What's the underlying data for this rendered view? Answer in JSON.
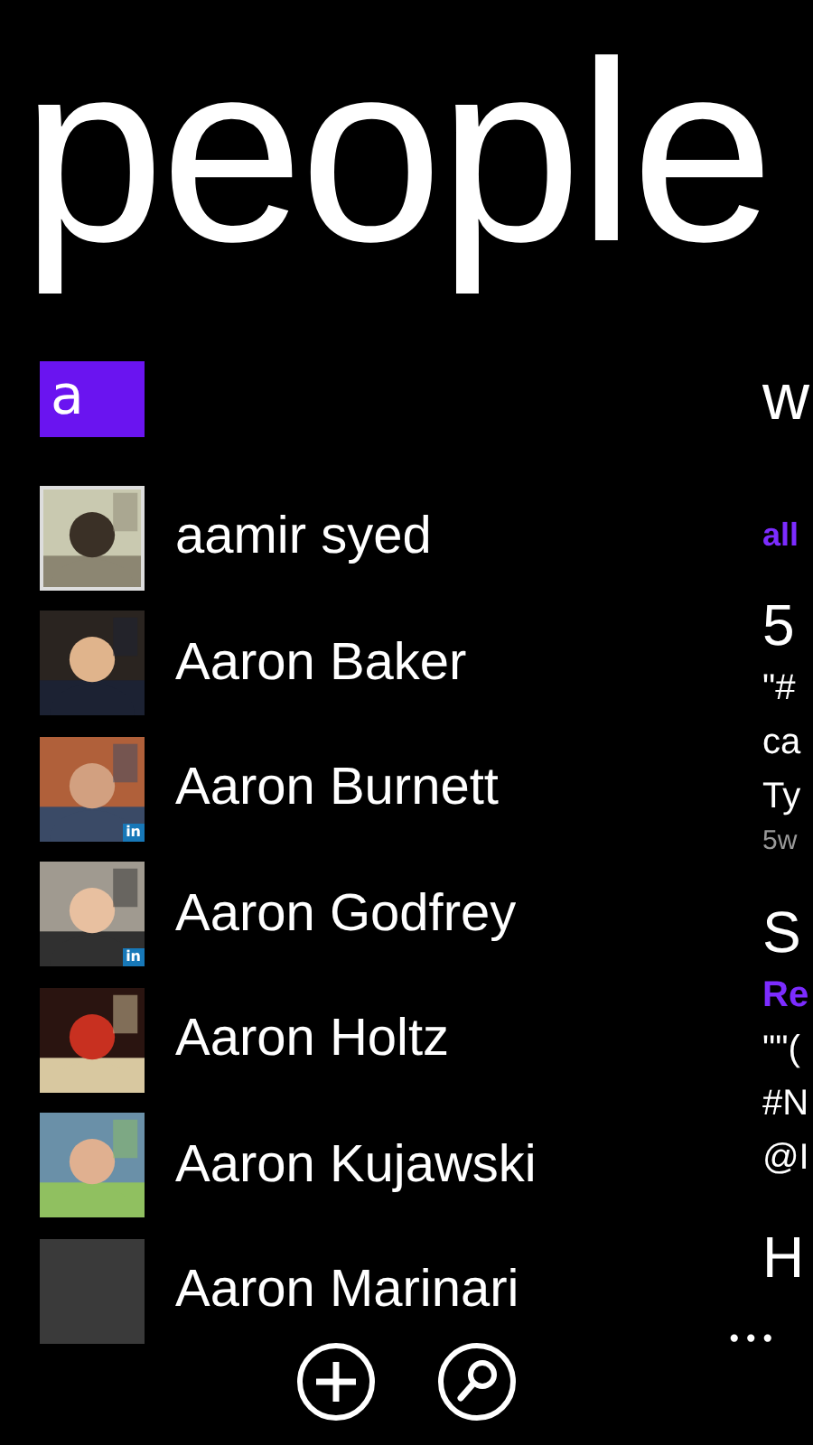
{
  "title": "people",
  "group_tile": {
    "label": "a"
  },
  "contacts": [
    {
      "name": "aamir syed"
    },
    {
      "name": "Aaron Baker"
    },
    {
      "name": "Aaron Burnett",
      "badge": "in"
    },
    {
      "name": "Aaron Godfrey",
      "badge": "in"
    },
    {
      "name": "Aaron Holtz"
    },
    {
      "name": "Aaron Kujawski"
    },
    {
      "name": "Aaron Marinari",
      "kind": "blank"
    }
  ],
  "next_panel": {
    "title": "w",
    "filter": "all",
    "posts": [
      {
        "author": "5",
        "lines": [
          "\"#",
          "ca",
          "Ty"
        ],
        "meta": "5w"
      },
      {
        "author": "S",
        "source": "Re",
        "lines": [
          "\"\"(",
          "#N",
          "@I"
        ]
      },
      {
        "author": "H"
      }
    ]
  },
  "app_bar": {
    "buttons": [
      {
        "kind": "add"
      },
      {
        "kind": "search"
      }
    ],
    "more": "•••"
  }
}
